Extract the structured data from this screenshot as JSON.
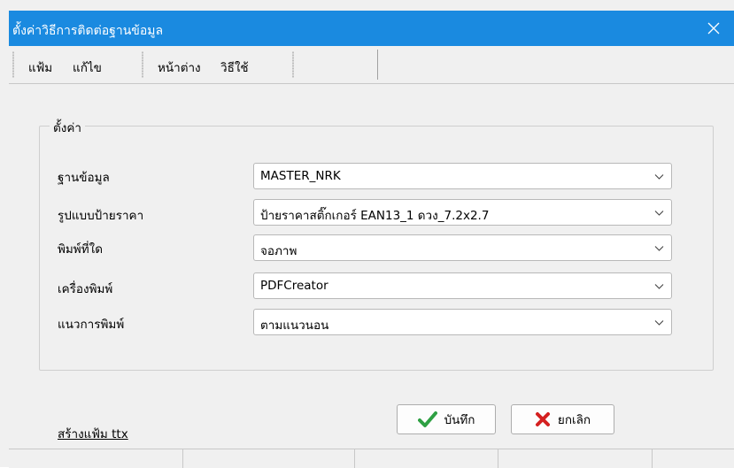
{
  "window": {
    "title": "ตั้งค่าวิธีการติดต่อฐานข้อมูล",
    "title_bar_color": "#1a8ae0"
  },
  "menubar": {
    "items": [
      {
        "label": "แฟ้ม"
      },
      {
        "label": "แก้ไข"
      },
      {
        "label": "หน้าต่าง"
      },
      {
        "label": "วิธีใช้"
      }
    ]
  },
  "settings": {
    "group_label": "ตั้งค่า",
    "fields": [
      {
        "label": "ฐานข้อมูล",
        "value": "MASTER_NRK"
      },
      {
        "label": "รูปแบบป้ายราคา",
        "value": "ป้ายราคาสติ๊กเกอร์ EAN13_1 ดวง_7.2x2.7"
      },
      {
        "label": "พิมพ์ที่ใด",
        "value": "จอภาพ"
      },
      {
        "label": "เครื่องพิมพ์",
        "value": "PDFCreator"
      },
      {
        "label": "แนวการพิมพ์",
        "value": "ตามแนวนอน"
      }
    ]
  },
  "footer": {
    "create_file_link": "สร้างแฟ้ม ttx",
    "save_label": "บันทึก",
    "cancel_label": "ยกเลิก",
    "save_icon_color": "#2ea043",
    "cancel_icon_color": "#d42020"
  }
}
